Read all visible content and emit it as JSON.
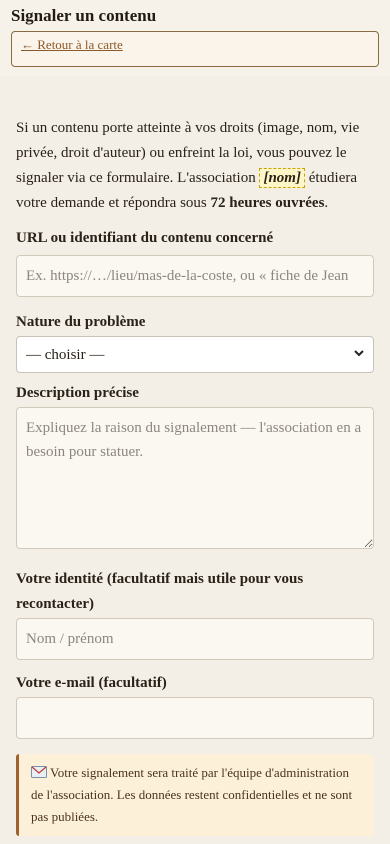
{
  "header": {
    "title": "Signaler un contenu",
    "back_link": "← Retour à la carte"
  },
  "intro": {
    "part1": "Si un contenu porte atteinte à vos droits (image, nom, vie privée, droit d'auteur) ou enfreint la loi, vous pouvez le signaler via ce formulaire. L'association ",
    "name_tag": "[nom]",
    "part2": " étudiera votre demande et répondra sous ",
    "deadline": "72 heures ouvrées",
    "part3": "."
  },
  "form": {
    "url": {
      "label": "URL ou identifiant du contenu concerné",
      "placeholder": "Ex. https://…/lieu/mas-de-la-coste, ou « fiche de Jean",
      "value": ""
    },
    "nature": {
      "label": "Nature du problème",
      "selected": "— choisir —"
    },
    "description": {
      "label": "Description précise",
      "placeholder": "Expliquez la raison du signalement — l'association en a besoin pour statuer."
    },
    "identity": {
      "label": "Votre identité (facultatif mais utile pour vous recontacter)",
      "placeholder": "Nom / prénom"
    },
    "email": {
      "label": "Votre e-mail (facultatif)",
      "placeholder": ""
    }
  },
  "notice": {
    "icon": "envelope-icon",
    "text": "Votre signalement sera traité par l'équipe d'administration de l'association. Les données restent confidentielles et ne sont pas publiées."
  },
  "colors": {
    "accent": "#8a5a2b",
    "notice_bg": "#fdf0d8",
    "page_bg": "#f3efe6"
  }
}
